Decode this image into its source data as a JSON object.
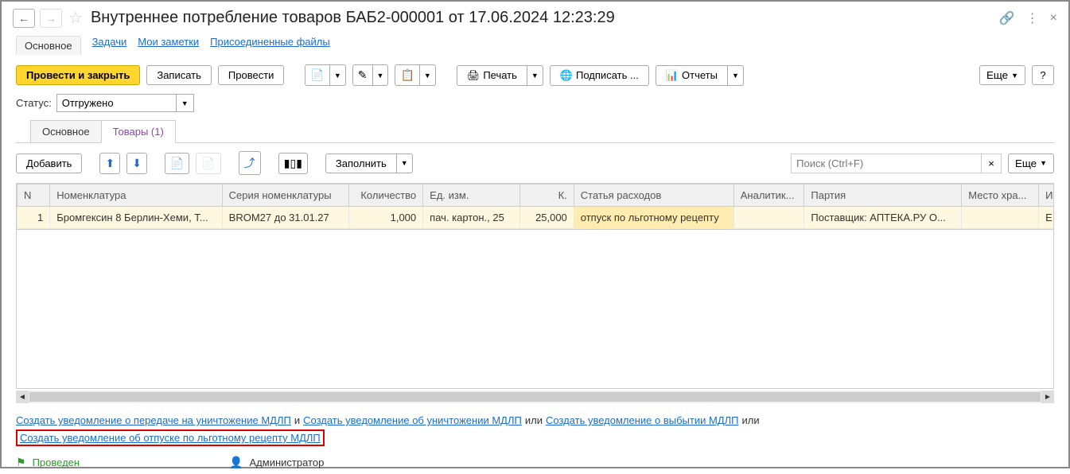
{
  "header": {
    "title": "Внутреннее потребление товаров БАБ2-000001 от 17.06.2024 12:23:29"
  },
  "tabs1": {
    "main": "Основное",
    "tasks": "Задачи",
    "notes": "Мои заметки",
    "files": "Присоединенные файлы"
  },
  "toolbar1": {
    "post_close": "Провести и закрыть",
    "save": "Записать",
    "post": "Провести",
    "print": "Печать",
    "sign": "Подписать ...",
    "reports": "Отчеты",
    "more": "Еще",
    "help": "?"
  },
  "status": {
    "label": "Статус:",
    "value": "Отгружено"
  },
  "tabs2": {
    "main": "Основное",
    "goods": "Товары (1)"
  },
  "toolbar2": {
    "add": "Добавить",
    "fill": "Заполнить",
    "search_placeholder": "Поиск (Ctrl+F)",
    "clear": "×",
    "more": "Еще"
  },
  "table": {
    "headers": {
      "n": "N",
      "nomenclature": "Номенклатура",
      "series": "Серия номенклатуры",
      "qty": "Количество",
      "unit": "Ед. изм.",
      "k": "К.",
      "expense": "Статья расходов",
      "analytics": "Аналитик...",
      "party": "Партия",
      "storage": "Место хра...",
      "last": "И"
    },
    "rows": [
      {
        "n": "1",
        "nomenclature": "Бромгексин 8 Берлин-Хеми, Т...",
        "series": "BROM27 до 31.01.27",
        "qty": "1,000",
        "unit": "пач. картон., 25",
        "k": "25,000",
        "expense": "отпуск по льготному рецепту",
        "analytics": "",
        "party": "Поставщик: АПТЕКА.РУ О...",
        "storage": "",
        "last": "Е"
      }
    ]
  },
  "links": {
    "l1": "Создать уведомление о передаче на уничтожение МДЛП",
    "and": "и",
    "l2": "Создать уведомление об уничтожении МДЛП",
    "or": "или",
    "l3": "Создать уведомление о выбытии МДЛП",
    "or2": "или",
    "l4": "Создать уведомление об отпуске по льготному рецепту МДЛП"
  },
  "footer": {
    "posted": "Проведен",
    "user": "Администратор"
  }
}
